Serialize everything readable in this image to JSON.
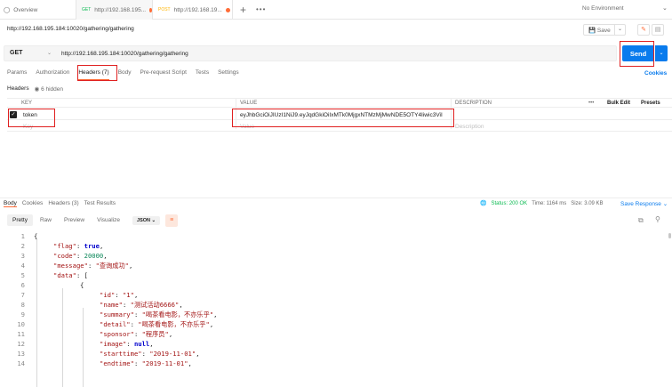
{
  "tabs": {
    "overview": "Overview",
    "req1_method": "GET",
    "req1_url": "http://192.168.195...",
    "req2_method": "POST",
    "req2_url": "http://192.168.19...",
    "add": "+",
    "more": "•••",
    "environment": "No Environment"
  },
  "request": {
    "title": "http://192.168.195.184:10020/gathering/gathering",
    "save_label": "Save",
    "method": "GET",
    "url": "http://192.168.195.184:10020/gathering/gathering",
    "send_label": "Send",
    "cookies_label": "Cookies"
  },
  "request_tabs": [
    "Params",
    "Authorization",
    "Headers (7)",
    "Body",
    "Pre-request Script",
    "Tests",
    "Settings"
  ],
  "headers_sub": {
    "title": "Headers",
    "hidden": "6 hidden"
  },
  "table": {
    "col_key": "KEY",
    "col_value": "VALUE",
    "col_description": "DESCRIPTION",
    "more": "•••",
    "bulk_edit": "Bulk Edit",
    "presets": "Presets",
    "row_key": "token",
    "row_value": "eyJhbGciOiJIUzI1NiJ9.eyJqdGkiOiIxMTk0MjgxNTMzMjMwNDE5OTY4Iiwic3ViI",
    "ph_key": "Key",
    "ph_value": "Value",
    "ph_description": "Description"
  },
  "response": {
    "tabs": [
      "Body",
      "Cookies",
      "Headers (3)",
      "Test Results"
    ],
    "status": "Status: 200 OK",
    "time": "Time: 1164 ms",
    "size": "Size: 3.09 KB",
    "save_response": "Save Response",
    "formats": [
      "Pretty",
      "Raw",
      "Preview",
      "Visualize"
    ],
    "format_select": "JSON"
  },
  "code_lines": [
    "1",
    "2",
    "3",
    "4",
    "5",
    "6",
    "7",
    "8",
    "9",
    "10",
    "11",
    "12",
    "13",
    "14"
  ],
  "json_body": {
    "flag_key": "\"flag\"",
    "flag_val": "true",
    "code_key": "\"code\"",
    "code_val": "20000",
    "message_key": "\"message\"",
    "message_val": "\"查询成功\"",
    "data_key": "\"data\"",
    "id_key": "\"id\"",
    "id_val": "\"1\"",
    "name_key": "\"name\"",
    "name_val": "\"测试活动6666\"",
    "summary_key": "\"summary\"",
    "summary_val": "\"喝茶看电影，不亦乐乎\"",
    "detail_key": "\"detail\"",
    "detail_val": "\"喝茶看电影，不亦乐乎\"",
    "sponsor_key": "\"sponsor\"",
    "sponsor_val": "\"程序员\"",
    "image_key": "\"image\"",
    "image_val": "null",
    "starttime_key": "\"starttime\"",
    "starttime_val": "\"2019-11-01\"",
    "endtime_key": "\"endtime\"",
    "endtime_val": "\"2019-11-01\""
  }
}
